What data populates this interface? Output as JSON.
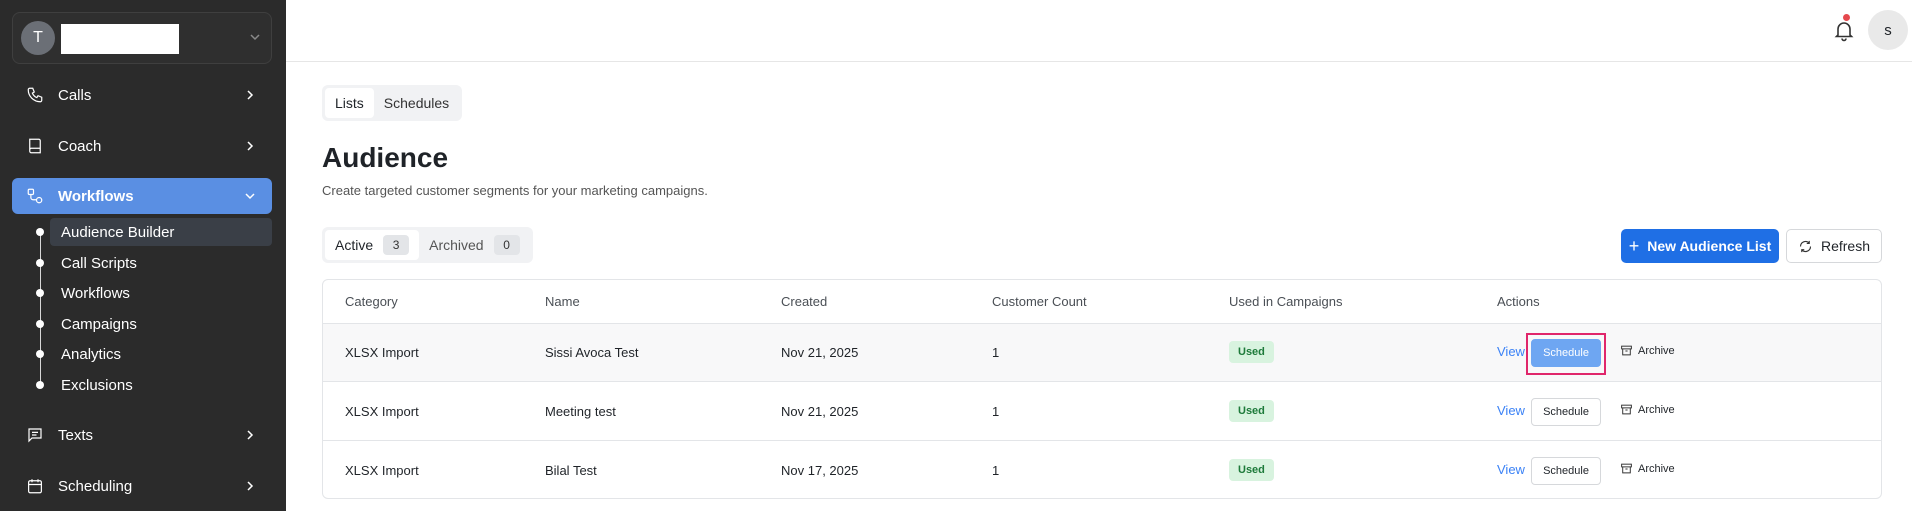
{
  "sidebar": {
    "org": {
      "avatar_letter": "T",
      "name": ""
    },
    "nav": [
      {
        "label": "Calls",
        "icon": "phone-icon"
      },
      {
        "label": "Coach",
        "icon": "book-icon"
      },
      {
        "label": "Workflows",
        "icon": "workflow-icon",
        "active": true
      },
      {
        "label": "Texts",
        "icon": "message-icon"
      },
      {
        "label": "Scheduling",
        "icon": "calendar-icon"
      }
    ],
    "subnav": [
      {
        "label": "Audience Builder",
        "active": true
      },
      {
        "label": "Call Scripts"
      },
      {
        "label": "Workflows"
      },
      {
        "label": "Campaigns"
      },
      {
        "label": "Analytics"
      },
      {
        "label": "Exclusions"
      }
    ]
  },
  "header": {
    "user_initial": "s",
    "has_notification": true
  },
  "view_tabs": [
    "Lists",
    "Schedules"
  ],
  "page": {
    "title": "Audience",
    "subtitle": "Create targeted customer segments for your marketing campaigns."
  },
  "status_tabs": [
    {
      "label": "Active",
      "count": "3"
    },
    {
      "label": "Archived",
      "count": "0"
    }
  ],
  "actions": {
    "new_list": "New Audience List",
    "refresh": "Refresh"
  },
  "table": {
    "headers": [
      "Category",
      "Name",
      "Created",
      "Customer Count",
      "Used in Campaigns",
      "Actions"
    ],
    "rows": [
      {
        "category": "XLSX Import",
        "name": "Sissi Avoca Test",
        "created": "Nov 21, 2025",
        "count": "1",
        "used": "Used",
        "view": "View",
        "schedule": "Schedule",
        "archive": "Archive"
      },
      {
        "category": "XLSX Import",
        "name": "Meeting test",
        "created": "Nov 21, 2025",
        "count": "1",
        "used": "Used",
        "view": "View",
        "schedule": "Schedule",
        "archive": "Archive"
      },
      {
        "category": "XLSX Import",
        "name": "Bilal Test",
        "created": "Nov 17, 2025",
        "count": "1",
        "used": "Used",
        "view": "View",
        "schedule": "Schedule",
        "archive": "Archive"
      }
    ]
  },
  "colors": {
    "accent": "#1f6fe5",
    "sidebar_bg": "#2b2b2b",
    "active_nav": "#5a8fe3",
    "used_badge": "#d8f3df",
    "highlight": "#e0266b"
  }
}
